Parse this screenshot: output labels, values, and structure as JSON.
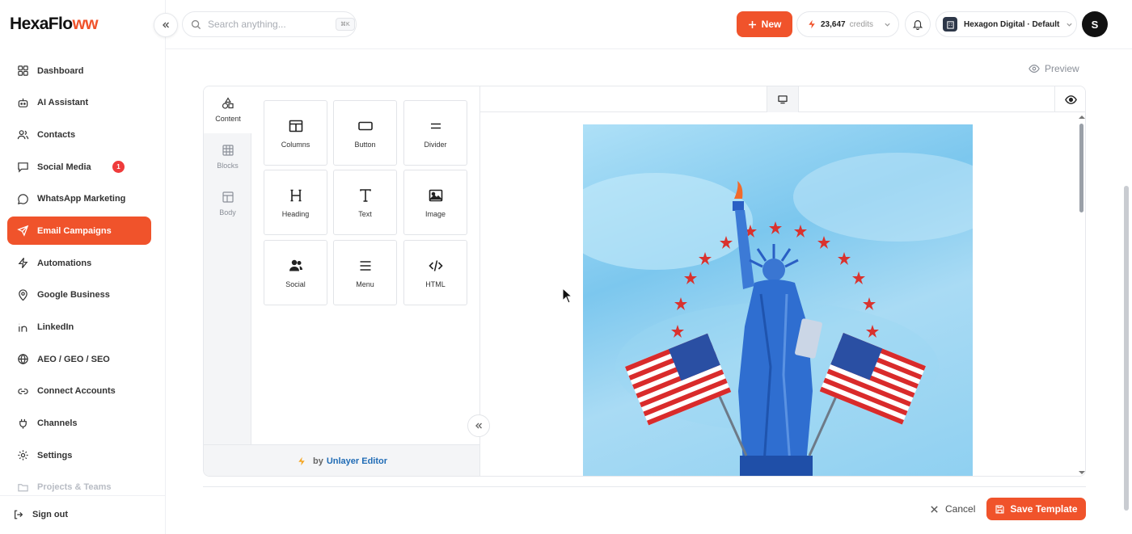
{
  "app": {
    "logo_main": "HexaFlo",
    "logo_accent": "ww"
  },
  "sidebar": {
    "items": [
      {
        "label": "Dashboard",
        "icon": "grid-icon"
      },
      {
        "label": "AI Assistant",
        "icon": "robot-icon"
      },
      {
        "label": "Contacts",
        "icon": "users-icon"
      },
      {
        "label": "Social Media",
        "icon": "chat-icon",
        "badge": "1"
      },
      {
        "label": "WhatsApp Marketing",
        "icon": "whatsapp-icon"
      },
      {
        "label": "Email Campaigns",
        "icon": "send-icon"
      },
      {
        "label": "Automations",
        "icon": "bolt-icon"
      },
      {
        "label": "Google Business",
        "icon": "pin-icon"
      },
      {
        "label": "LinkedIn",
        "icon": "linkedin-icon"
      },
      {
        "label": "AEO / GEO / SEO",
        "icon": "globe-icon"
      },
      {
        "label": "Connect Accounts",
        "icon": "link-icon"
      },
      {
        "label": "Channels",
        "icon": "plug-icon"
      },
      {
        "label": "Settings",
        "icon": "gear-icon"
      },
      {
        "label": "Projects & Teams",
        "icon": "folder-icon"
      }
    ],
    "signout": "Sign out"
  },
  "topbar": {
    "search_placeholder": "Search anything...",
    "search_kbd": "⌘K",
    "new_label": "New",
    "credits_value": "23,647",
    "credits_label": "credits",
    "workspace": "Hexagon Digital · Default",
    "avatar_initial": "S"
  },
  "main": {
    "preview_label": "Preview",
    "tabs": [
      {
        "label": "Content",
        "icon": "shapes-icon"
      },
      {
        "label": "Blocks",
        "icon": "blocks-icon"
      },
      {
        "label": "Body",
        "icon": "layout-icon"
      }
    ],
    "tools": [
      {
        "label": "Columns",
        "icon": "columns-icon"
      },
      {
        "label": "Button",
        "icon": "button-icon"
      },
      {
        "label": "Divider",
        "icon": "divider-icon"
      },
      {
        "label": "Heading",
        "icon": "heading-icon"
      },
      {
        "label": "Text",
        "icon": "text-icon"
      },
      {
        "label": "Image",
        "icon": "image-icon"
      },
      {
        "label": "Social",
        "icon": "social-icon"
      },
      {
        "label": "Menu",
        "icon": "menu-icon"
      },
      {
        "label": "HTML",
        "icon": "code-icon"
      }
    ],
    "powered_by": "by",
    "powered_brand": "Unlayer Editor",
    "cancel_label": "Cancel",
    "save_label": "Save Template"
  },
  "colors": {
    "accent": "#f0532b",
    "badge": "#ef3b3b",
    "brand_link": "#1f6bb5"
  }
}
